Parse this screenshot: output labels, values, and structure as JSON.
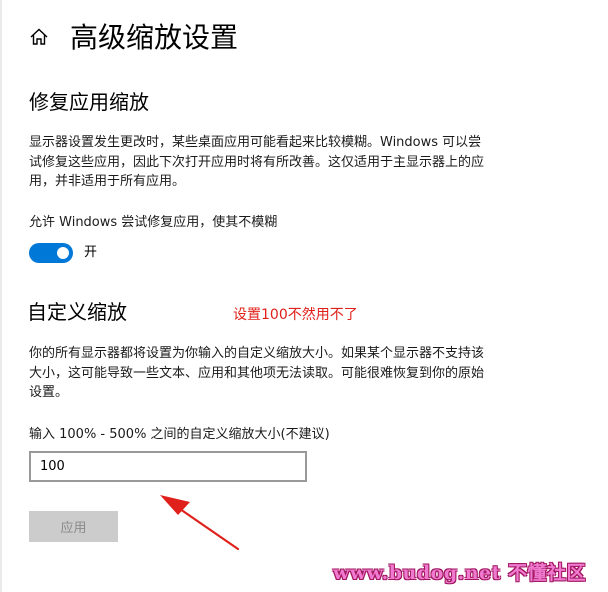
{
  "header": {
    "title": "高级缩放设置",
    "home_icon": "home-icon"
  },
  "fix_scaling": {
    "title": "修复应用缩放",
    "description": "显示器设置发生更改时，某些桌面应用可能看起来比较模糊。Windows 可以尝试修复这些应用，因此下次打开应用时将有所改善。这仅适用于主显示器上的应用，并非适用于所有应用。",
    "toggle_label": "允许 Windows 尝试修复应用，使其不模糊",
    "toggle_on": true,
    "toggle_state": "开"
  },
  "custom_scaling": {
    "title": "自定义缩放",
    "annotation": "设置100不然用不了",
    "description": "你的所有显示器都将设置为你输入的自定义缩放大小。如果某个显示器不支持该大小，这可能导致一些文本、应用和其他项无法读取。可能很难恢复到你的原始设置。",
    "input_label": "输入 100% - 500% 之间的自定义缩放大小(不建议)",
    "input_value": "100",
    "apply_label": "应用"
  },
  "colors": {
    "accent": "#0078d7",
    "annotation": "#e0201b",
    "disabled_button": "#cccccc"
  },
  "watermark": "www.budog.net 不懂社区"
}
